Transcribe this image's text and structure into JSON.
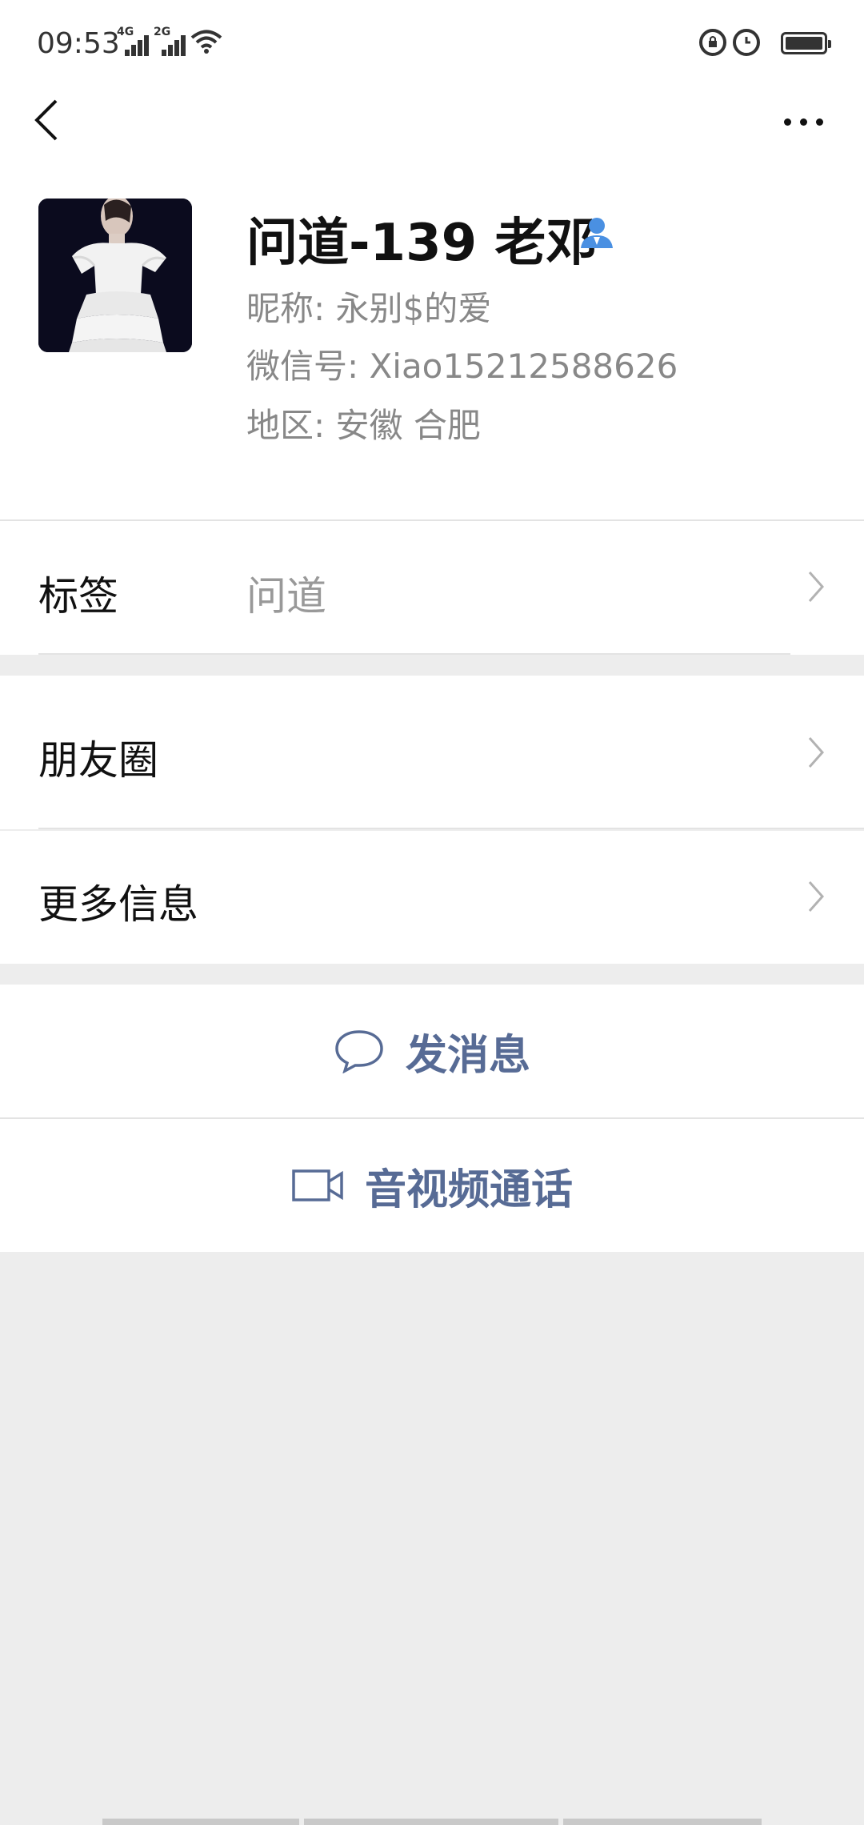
{
  "status_bar": {
    "time": "09:53",
    "signal_1_label": "4G",
    "signal_2_label": "2G",
    "icons": [
      "signal-icon",
      "wifi-icon",
      "lock-rotation-icon",
      "alarm-icon",
      "battery-icon"
    ]
  },
  "nav": {
    "back_icon": "chevron-left-icon",
    "more_icon": "more-dots-icon"
  },
  "profile": {
    "display_name": "问道-139 老邓",
    "nickname_line": "昵称: 永别$的爱",
    "wechat_id_line": "微信号: Xiao15212588626",
    "region_line": "地区: 安徽  合肥",
    "star_icon": "user-friend-icon",
    "avatar_desc": "photo"
  },
  "rows": {
    "tags_label": "标签",
    "tags_value": "问道",
    "moments_label": "朋友圈",
    "more_info_label": "更多信息"
  },
  "actions": {
    "send_message": "发消息",
    "video_call": "音视频通话"
  },
  "colors": {
    "link": "#576b95",
    "background": "#ededed",
    "card": "#ffffff",
    "icon_blue": "#4a90e2"
  }
}
